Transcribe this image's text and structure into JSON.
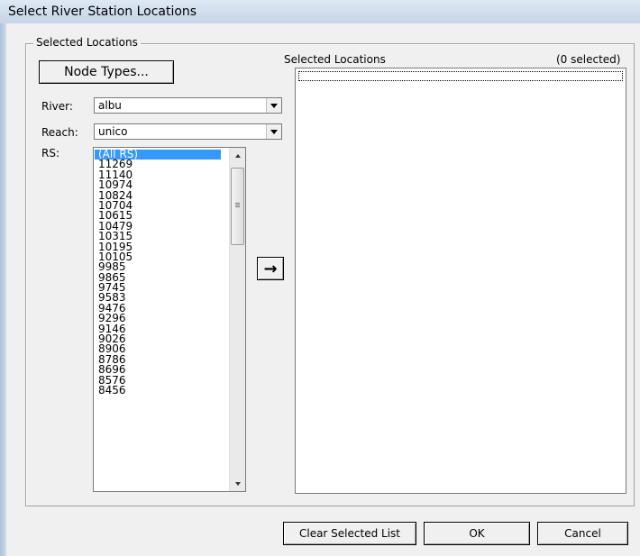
{
  "window": {
    "title": "Select River Station Locations"
  },
  "group": {
    "label": "Selected Locations"
  },
  "node_types_button": "Node Types...",
  "river": {
    "label": "River:",
    "value": "albu"
  },
  "reach": {
    "label": "Reach:",
    "value": "unico"
  },
  "rs": {
    "label": "RS:",
    "items": [
      "(All RS)",
      "11269",
      "11140",
      "10974",
      "10824",
      "10704",
      "10615",
      "10479",
      "10315",
      "10195",
      "10105",
      "9985",
      "9865",
      "9745",
      "9583",
      "9476",
      "9296",
      "9146",
      "9026",
      "8906",
      "8786",
      "8696",
      "8576",
      "8456"
    ],
    "selected_index": 0
  },
  "add_arrow_icon": "right-arrow-icon",
  "selected_list": {
    "header": "Selected Locations",
    "count": "(0 selected)"
  },
  "buttons": {
    "clear": "Clear Selected List",
    "ok": "OK",
    "cancel": "Cancel"
  }
}
